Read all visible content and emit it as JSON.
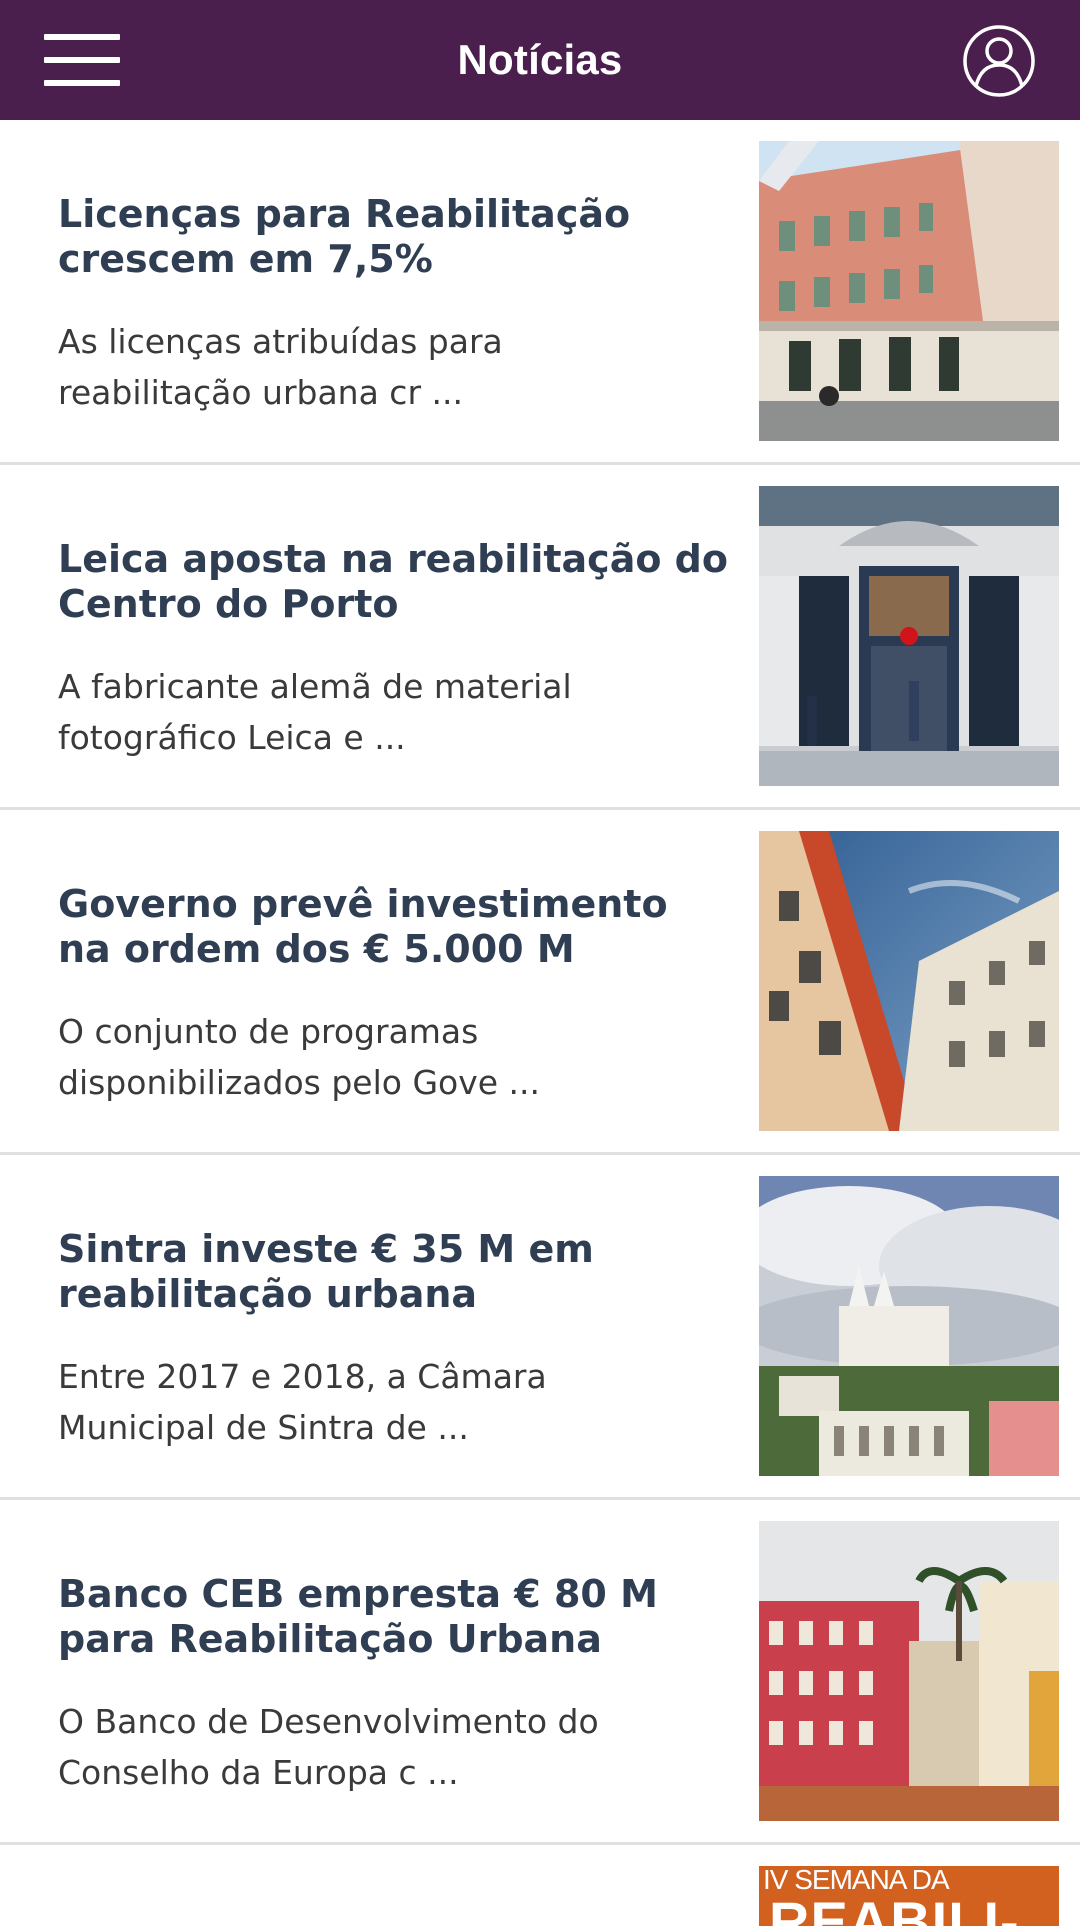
{
  "header": {
    "title": "Notícias",
    "menu_icon": "hamburger-menu-icon",
    "profile_icon": "user-profile-icon",
    "background": "#4a1f4d"
  },
  "news": [
    {
      "title": "Licenças para Reabilitação crescem em 7,5%",
      "summary": "As licenças atribuídas para reabilitação urbana cr ..."
    },
    {
      "title": "Leica aposta na reabilitação do Centro do Porto",
      "summary": "A fabricante alemã de material fotográfico Leica e ..."
    },
    {
      "title": "Governo prevê investimento na ordem dos € 5.000 M",
      "summary": "O conjunto de programas disponibilizados pelo Gove ..."
    },
    {
      "title": "Sintra investe € 35 M em reabilitação urbana",
      "summary": "Entre 2017 e 2018, a Câmara Municipal de Sintra de ..."
    },
    {
      "title": "Banco CEB empresta € 80 M para Reabilitação Urbana",
      "summary": "O Banco de Desenvolvimento do Conselho da Europa c ..."
    }
  ],
  "partial_item": {
    "thumb_line1": "IV SEMANA DA",
    "thumb_line2": "REABILI-"
  }
}
